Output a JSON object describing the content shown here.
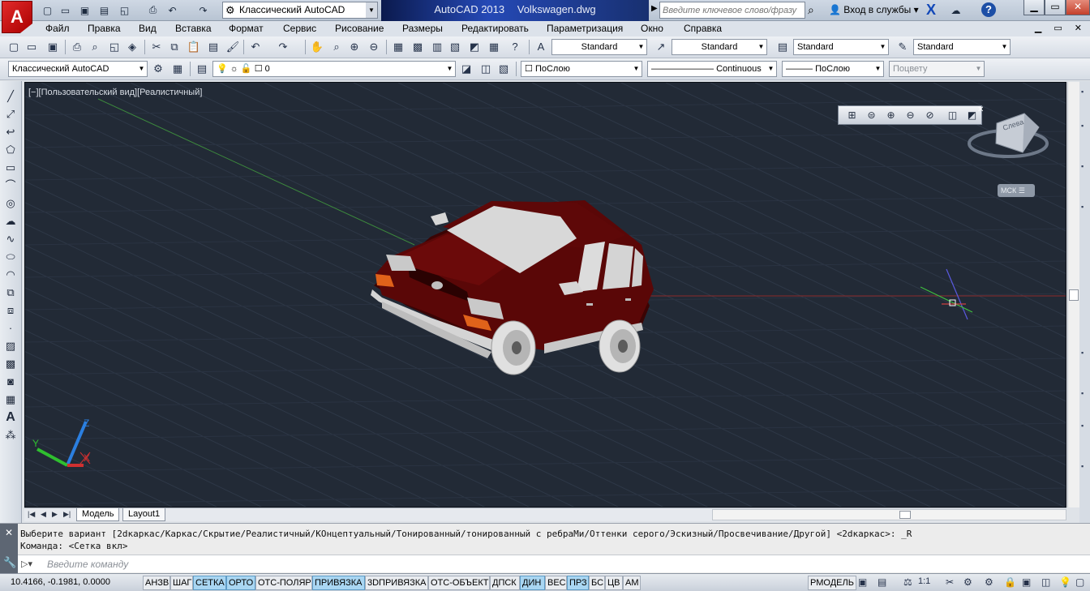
{
  "title_bar": {
    "workspace": "Классический AutoCAD",
    "app_name": "AutoCAD 2013",
    "file_name": "Volkswagen.dwg",
    "search_placeholder": "Введите ключевое слово/фразу",
    "login_label": "Вход в службы"
  },
  "menu": {
    "items": [
      "Файл",
      "Правка",
      "Вид",
      "Вставка",
      "Формат",
      "Сервис",
      "Рисование",
      "Размеры",
      "Редактировать",
      "Параметризация",
      "Окно",
      "Справка"
    ]
  },
  "toolbar1": {
    "text_style": "Standard",
    "dim_style": "Standard",
    "table_style": "Standard",
    "mleader_style": "Standard"
  },
  "toolbar2": {
    "workspace": "Классический AutoCAD",
    "layer": "0",
    "color": "ПоСлою",
    "linetype": "Continuous",
    "lineweight": "ПоСлою",
    "plot_style": "Поцвету"
  },
  "viewport": {
    "label": "[−][Пользовательский вид][Реалистичный]",
    "viewcube_face": "Слева",
    "wcs_button": "МСК ☰",
    "axis_x": "X",
    "axis_y": "Y",
    "axis_z": "Z",
    "colors": {
      "background": "#222a36",
      "car_body": "#5a0707",
      "glass": "#dcdcdc"
    }
  },
  "layout_tabs": [
    "Модель",
    "Layout1"
  ],
  "command": {
    "line1": "Выберите вариант [2dкаркас/Каркас/Скрытие/Реалистичный/КОнцептуальный/Тонированный/тонированный с ребраМи/Оттенки серого/Эскизный/Просвечивание/Другой] <2dкаркас>: _R",
    "line2": "Команда:  <Сетка вкл>",
    "input_placeholder": "Введите команду"
  },
  "status": {
    "coords": "10.4166, -0.1981, 0.0000",
    "buttons": [
      {
        "label": "АНЗВ",
        "on": false
      },
      {
        "label": "ШАГ",
        "on": false
      },
      {
        "label": "СЕТКА",
        "on": true
      },
      {
        "label": "ОРТО",
        "on": true
      },
      {
        "label": "ОТС-ПОЛЯР",
        "on": false
      },
      {
        "label": "ПРИВЯЗКА",
        "on": true
      },
      {
        "label": "3DПРИВЯЗКА",
        "on": false
      },
      {
        "label": "ОТС-ОБЪЕКТ",
        "on": false
      },
      {
        "label": "ДПСК",
        "on": false
      },
      {
        "label": "ДИН",
        "on": true
      },
      {
        "label": "ВЕС",
        "on": false
      },
      {
        "label": "ПРЗ",
        "on": true
      },
      {
        "label": "БС",
        "on": false
      },
      {
        "label": "ЦВ",
        "on": false
      },
      {
        "label": "АМ",
        "on": false
      }
    ],
    "model_space": "РМОДЕЛЬ",
    "scale": "1:1"
  }
}
